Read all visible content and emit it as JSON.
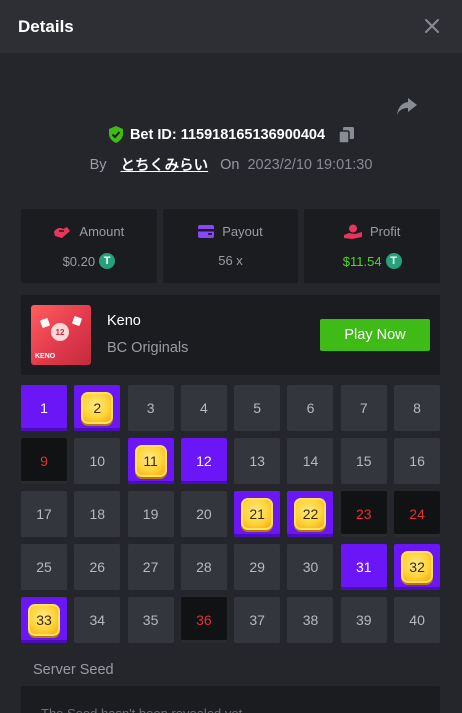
{
  "header": {
    "title": "Details",
    "close_icon": "close-icon"
  },
  "bet": {
    "id_label": "Bet ID: 115918165136900404",
    "by_label": "By",
    "user": "とちくみらい",
    "on_label": "On",
    "date": "2023/2/10 19:01:30"
  },
  "stats": {
    "amount": {
      "label": "Amount",
      "value": "$0.20",
      "icon": "amount-icon"
    },
    "payout": {
      "label": "Payout",
      "value": "56 x",
      "icon": "payout-icon"
    },
    "profit": {
      "label": "Profit",
      "value": "$11.54",
      "icon": "profit-icon"
    },
    "coin_symbol": "T"
  },
  "game": {
    "name": "Keno",
    "provider": "BC Originals",
    "play_label": "Play Now",
    "thumb_ball": "12",
    "thumb_label": "KENO"
  },
  "grid": {
    "cells": [
      {
        "n": "1",
        "s": "picked"
      },
      {
        "n": "2",
        "s": "hit"
      },
      {
        "n": "3",
        "s": ""
      },
      {
        "n": "4",
        "s": ""
      },
      {
        "n": "5",
        "s": ""
      },
      {
        "n": "6",
        "s": ""
      },
      {
        "n": "7",
        "s": ""
      },
      {
        "n": "8",
        "s": ""
      },
      {
        "n": "9",
        "s": "miss"
      },
      {
        "n": "10",
        "s": ""
      },
      {
        "n": "11",
        "s": "hit"
      },
      {
        "n": "12",
        "s": "picked"
      },
      {
        "n": "13",
        "s": ""
      },
      {
        "n": "14",
        "s": ""
      },
      {
        "n": "15",
        "s": ""
      },
      {
        "n": "16",
        "s": ""
      },
      {
        "n": "17",
        "s": ""
      },
      {
        "n": "18",
        "s": ""
      },
      {
        "n": "19",
        "s": ""
      },
      {
        "n": "20",
        "s": ""
      },
      {
        "n": "21",
        "s": "hit"
      },
      {
        "n": "22",
        "s": "hit"
      },
      {
        "n": "23",
        "s": "miss"
      },
      {
        "n": "24",
        "s": "miss"
      },
      {
        "n": "25",
        "s": ""
      },
      {
        "n": "26",
        "s": ""
      },
      {
        "n": "27",
        "s": ""
      },
      {
        "n": "28",
        "s": ""
      },
      {
        "n": "29",
        "s": ""
      },
      {
        "n": "30",
        "s": ""
      },
      {
        "n": "31",
        "s": "picked"
      },
      {
        "n": "32",
        "s": "hit"
      },
      {
        "n": "33",
        "s": "hit"
      },
      {
        "n": "34",
        "s": ""
      },
      {
        "n": "35",
        "s": ""
      },
      {
        "n": "36",
        "s": "miss"
      },
      {
        "n": "37",
        "s": ""
      },
      {
        "n": "38",
        "s": ""
      },
      {
        "n": "39",
        "s": ""
      },
      {
        "n": "40",
        "s": ""
      }
    ]
  },
  "seed": {
    "label": "Server Seed",
    "value": "The Seed hasn't been revealed yet"
  },
  "colors": {
    "accent_purple": "#6a16f7",
    "play_green": "#3fbb17",
    "profit_green": "#4bd529",
    "miss_red": "#e0303a",
    "gem_yellow": "#ffd438"
  }
}
